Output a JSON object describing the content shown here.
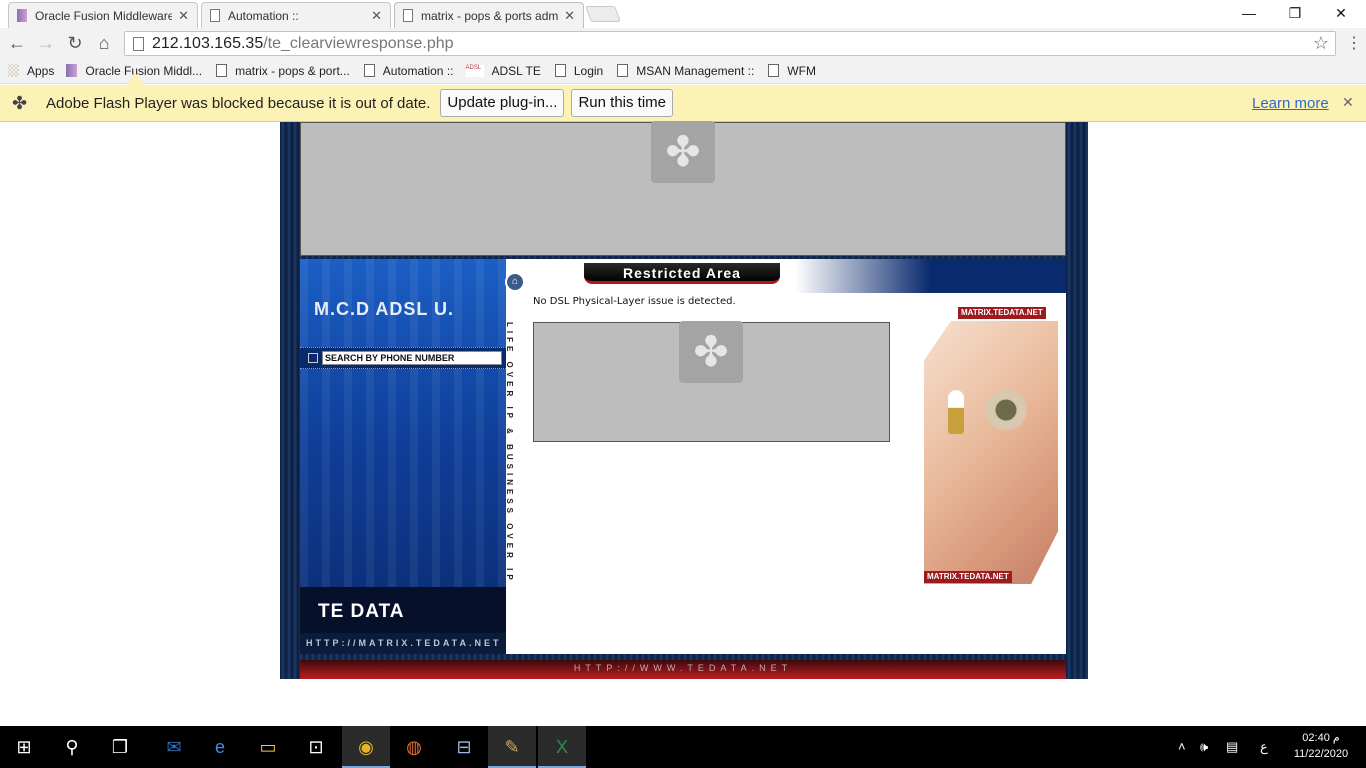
{
  "tabs": [
    {
      "title": "Oracle Fusion Middleware",
      "icon": "oracle-icon"
    },
    {
      "title": "Automation ::",
      "icon": "page-icon"
    },
    {
      "title": "matrix - pops & ports adm",
      "icon": "page-icon"
    }
  ],
  "toolbar": {
    "url_host": "212.103.165.35",
    "url_path": "/te_clearviewresponse.php"
  },
  "bookmarks": [
    {
      "label": "Apps",
      "icon": "apps-icon"
    },
    {
      "label": "Oracle Fusion Middl...",
      "icon": "oracle-icon"
    },
    {
      "label": "matrix - pops & port...",
      "icon": "page-icon"
    },
    {
      "label": "Automation ::",
      "icon": "page-icon"
    },
    {
      "label": "ADSL TE",
      "icon": "adsl-icon"
    },
    {
      "label": "Login",
      "icon": "page-icon"
    },
    {
      "label": "MSAN Management ::",
      "icon": "page-icon"
    },
    {
      "label": "WFM",
      "icon": "page-icon"
    }
  ],
  "infobar": {
    "message": "Adobe Flash Player was blocked because it is out of date.",
    "update_button": "Update plug-in...",
    "run_button": "Run this time",
    "learn_more": "Learn more"
  },
  "site": {
    "brand": "M.C.D ADSL U.",
    "search_label": "SEARCH BY PHONE NUMBER",
    "company": "TE DATA",
    "left_url": "HTTP://MATRIX.TEDATA.NET",
    "vertical_slogan": "LIFE OVER IP & BUSINESS OVER IP",
    "section_title": "Restricted Area",
    "status_message": "No DSL Physical-Layer issue is detected.",
    "ad_label_top": "MATRIX.TEDATA.NET",
    "ad_label_bottom": "MATRIX.TEDATA.NET",
    "footer_url": "HTTP://WWW.TEDATA.NET"
  },
  "taskbar": {
    "apps": [
      "start",
      "search",
      "task-view",
      "outlook",
      "edge",
      "file-explorer",
      "store",
      "chrome",
      "firefox",
      "network-tool",
      "paint",
      "excel"
    ],
    "time": "02:40 م",
    "date": "11/22/2020",
    "lang": "ع"
  }
}
